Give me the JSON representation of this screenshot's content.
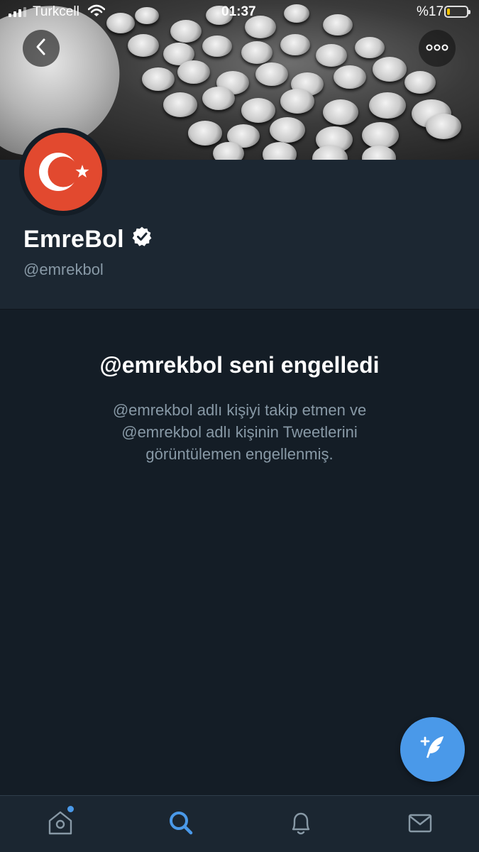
{
  "status_bar": {
    "carrier": "Turkcell",
    "time": "01:37",
    "battery_percent_text": "%17",
    "battery_level": 0.17,
    "battery_color": "#f5c400",
    "icons": [
      "signal-icon",
      "wifi-icon",
      "battery-icon"
    ]
  },
  "header": {
    "back_icon": "chevron-left-icon",
    "more_icon": "more-dots-icon"
  },
  "profile": {
    "display_name": "EmreBol",
    "verified": true,
    "handle": "@emrekbol",
    "avatar_icon": "turkish-flag-icon",
    "avatar_color": "#e2492f"
  },
  "blocked": {
    "title": "@emrekbol seni engelledi",
    "description_lines": [
      "@emrekbol adlı kişiyi takip etmen ve",
      "@emrekbol adlı kişinin Tweetlerini",
      "görüntülemen engellenmiş."
    ]
  },
  "fab": {
    "icon": "compose-tweet-icon",
    "color": "#4a99e9"
  },
  "tab_bar": {
    "tabs": [
      {
        "name": "home",
        "icon": "home-icon",
        "has_badge": true
      },
      {
        "name": "search",
        "icon": "search-icon",
        "active": true
      },
      {
        "name": "notifications",
        "icon": "bell-icon"
      },
      {
        "name": "messages",
        "icon": "mail-icon"
      }
    ],
    "active_color": "#4a99e9",
    "inactive_color": "#8899a6"
  },
  "colors": {
    "background": "#141d26",
    "profile_background": "#1c2732",
    "secondary_text": "#8899a6",
    "accent": "#4a99e9"
  }
}
